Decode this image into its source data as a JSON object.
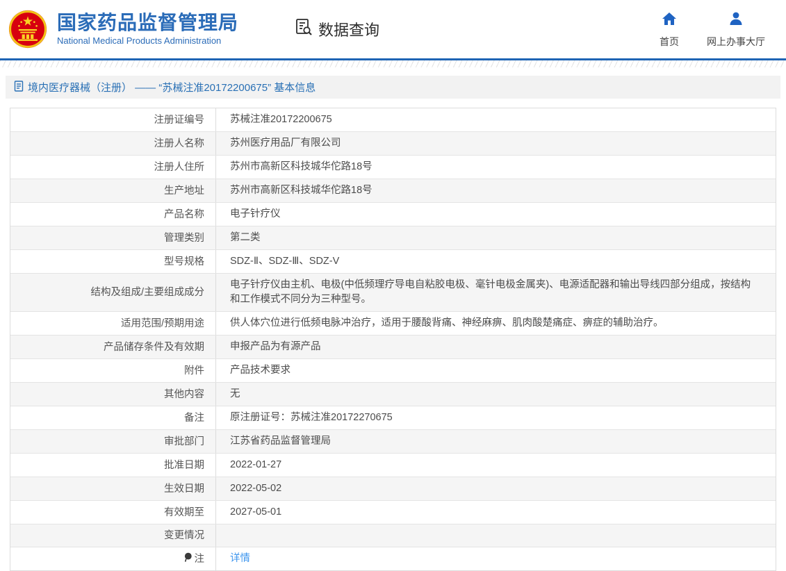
{
  "colors": {
    "accent_blue": "#2b6cb8",
    "rule_blue": "#1e64b4",
    "link_blue": "#3e96ee",
    "title_bar_bg": "#f2f2f2",
    "row_stripe_bg": "#f5f5f5"
  },
  "header": {
    "agency_cn": "国家药品监督管理局",
    "agency_en": "National Medical Products Administration",
    "section_label": "数据查询",
    "nav": [
      {
        "label": "首页",
        "icon": "home-icon"
      },
      {
        "label": "网上办事大厅",
        "icon": "user-icon"
      }
    ]
  },
  "page": {
    "title": "境内医疗器械（注册） —— “苏械注准20172200675” 基本信息"
  },
  "table": {
    "rows": [
      {
        "label": "注册证编号",
        "value": "苏械注准20172200675"
      },
      {
        "label": "注册人名称",
        "value": "苏州医疗用品厂有限公司"
      },
      {
        "label": "注册人住所",
        "value": "苏州市高新区科技城华佗路18号"
      },
      {
        "label": "生产地址",
        "value": "苏州市高新区科技城华佗路18号"
      },
      {
        "label": "产品名称",
        "value": "电子针疗仪"
      },
      {
        "label": "管理类别",
        "value": "第二类"
      },
      {
        "label": "型号规格",
        "value": "SDZ-Ⅱ、SDZ-Ⅲ、SDZ-V"
      },
      {
        "label": "结构及组成/主要组成成分",
        "value": "电子针疗仪由主机、电极(中低频理疗导电自粘胶电极、毫针电极金属夹)、电源适配器和输出导线四部分组成，按结构和工作模式不同分为三种型号。"
      },
      {
        "label": "适用范围/预期用途",
        "value": "供人体穴位进行低频电脉冲治疗，适用于腰酸背痛、神经麻痹、肌肉酸楚痛症、痹症的辅助治疗。"
      },
      {
        "label": "产品储存条件及有效期",
        "value": "申报产品为有源产品"
      },
      {
        "label": "附件",
        "value": "产品技术要求"
      },
      {
        "label": "其他内容",
        "value": "无"
      },
      {
        "label": "备注",
        "value": "原注册证号：苏械注准20172270675"
      },
      {
        "label": "审批部门",
        "value": "江苏省药品监督管理局"
      },
      {
        "label": "批准日期",
        "value": "2022-01-27"
      },
      {
        "label": "生效日期",
        "value": "2022-05-02"
      },
      {
        "label": "有效期至",
        "value": "2027-05-01"
      },
      {
        "label": "变更情况",
        "value": ""
      },
      {
        "label": "注",
        "value": "详情",
        "link": true,
        "label_icon": "balloon-note-icon"
      }
    ]
  }
}
